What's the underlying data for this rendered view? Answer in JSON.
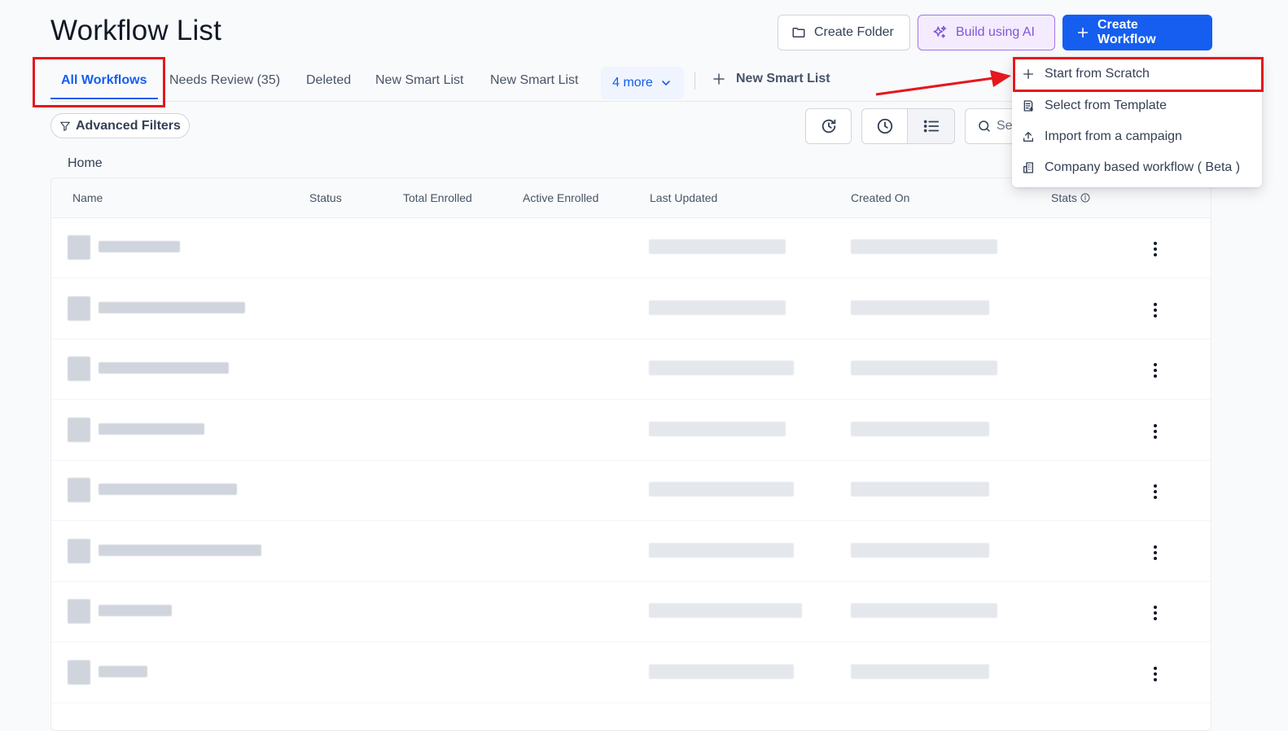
{
  "header": {
    "title": "Workflow List",
    "create_folder_label": "Create Folder",
    "build_ai_label": "Build using AI",
    "create_workflow_label": "Create Workflow"
  },
  "tabs": {
    "items": [
      "All Workflows",
      "Needs Review (35)",
      "Deleted",
      "New Smart List",
      "New Smart List"
    ],
    "more_label": "4 more",
    "new_smart_list_label": "New Smart List",
    "active": "All Workflows"
  },
  "toolbar": {
    "advanced_filters_label": "Advanced Filters",
    "search_placeholder": "Se"
  },
  "breadcrumb": {
    "home": "Home"
  },
  "table": {
    "columns": [
      "Name",
      "Status",
      "Total Enrolled",
      "Active Enrolled",
      "Last Updated",
      "Created On",
      "Stats"
    ],
    "row_count": 8
  },
  "dropdown": {
    "items": [
      "Start from Scratch",
      "Select from Template",
      "Import from a campaign",
      "Company based workflow ( Beta )"
    ],
    "highlighted": "Start from Scratch"
  },
  "colors": {
    "primary": "#155eef",
    "ai_purple": "#7f56d9",
    "annotation_red": "#e4181d"
  }
}
